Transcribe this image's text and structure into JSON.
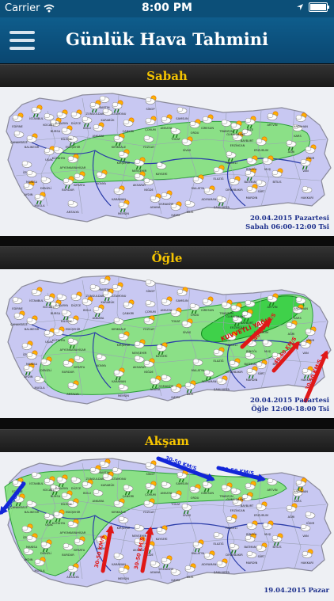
{
  "status_bar": {
    "carrier": "Carrier",
    "time": "8:00 PM"
  },
  "nav": {
    "title": "Günlük Hava Tahmini"
  },
  "sections": [
    {
      "title": "Sabah",
      "date": "20.04.2015 Pazartesi",
      "period": "Sabah 06:00-12:00 Tsi",
      "annotations": []
    },
    {
      "title": "Öğle",
      "date": "20.04.2015 Pazartesi",
      "period": "Öğle 12:00-18:00 Tsi",
      "annotations": [
        "KUVVETLİ YAĞIŞ",
        "40-60 KM/S",
        "40-60 KM/S",
        "30-50 KM/S"
      ]
    },
    {
      "title": "Akşam",
      "date": "19.04.2015 Pazar",
      "period": "",
      "annotations": [
        "30-50 KM/S",
        "30-50 KM/S",
        "30-50 KM/S",
        "30-50 KM/S",
        "30-50 KM/S"
      ]
    }
  ],
  "cities": [
    "KASTAMONU",
    "SİNOP",
    "SAMSUN",
    "ANKARA",
    "KIRIKKALE",
    "YOZGAT",
    "SİVAS",
    "ERZİNCAN",
    "TUNCELİ",
    "ELAZIĞ",
    "MALATYA",
    "KAYSERİ",
    "NEVŞEHİR",
    "KONYA",
    "ANTALYA",
    "ADANA",
    "MERSİN",
    "İZMİR",
    "UŞAK",
    "AFYONKARAHİSAR",
    "ESKİŞEHİR",
    "BALIKESİR",
    "BİTLİS",
    "HAKKARİ",
    "VAN",
    "MUŞ",
    "KARS",
    "ARTVİN",
    "RİZE",
    "TRABZON",
    "GİRESUN",
    "ORDU",
    "TOKAT",
    "AMASYA",
    "ÇORUM",
    "KARABÜK",
    "KIRŞEHİR",
    "AKSARAY",
    "NİĞDE",
    "MARDİN",
    "BATMAN",
    "SİİRT",
    "DİYARBAKIR",
    "ADIYAMAN",
    "ŞANLIURFA",
    "HATAY",
    "OSMANİYE",
    "KİLİS",
    "BURDUR",
    "ISPARTA",
    "DENİZLİ",
    "AYDIN",
    "MUĞLA",
    "MANİSA",
    "BURSA",
    "BİLECİK",
    "BOLU",
    "DÜZCE",
    "SAKARYA",
    "KOCAELİ",
    "İSTANBUL",
    "EDİRNE",
    "ÇANAKKALE",
    "KARAMAN",
    "ZONGULDAK",
    "BARTIN",
    "ÇANKIRI",
    "ERZURUM",
    "AĞRI",
    "IĞDIR",
    "ARDAHAN",
    "BAYBURT",
    "GÜMÜŞHANE",
    "BİNGÖL",
    "KÜTAHYA"
  ],
  "colors": {
    "rain_area": "#86e37f",
    "heavy_rain_area": "#3fd14a",
    "wind_arrow_red": "#e01818",
    "wind_arrow_blue": "#1226d8",
    "heading_text": "#f5c400",
    "caption_text": "#1c2f8c"
  }
}
